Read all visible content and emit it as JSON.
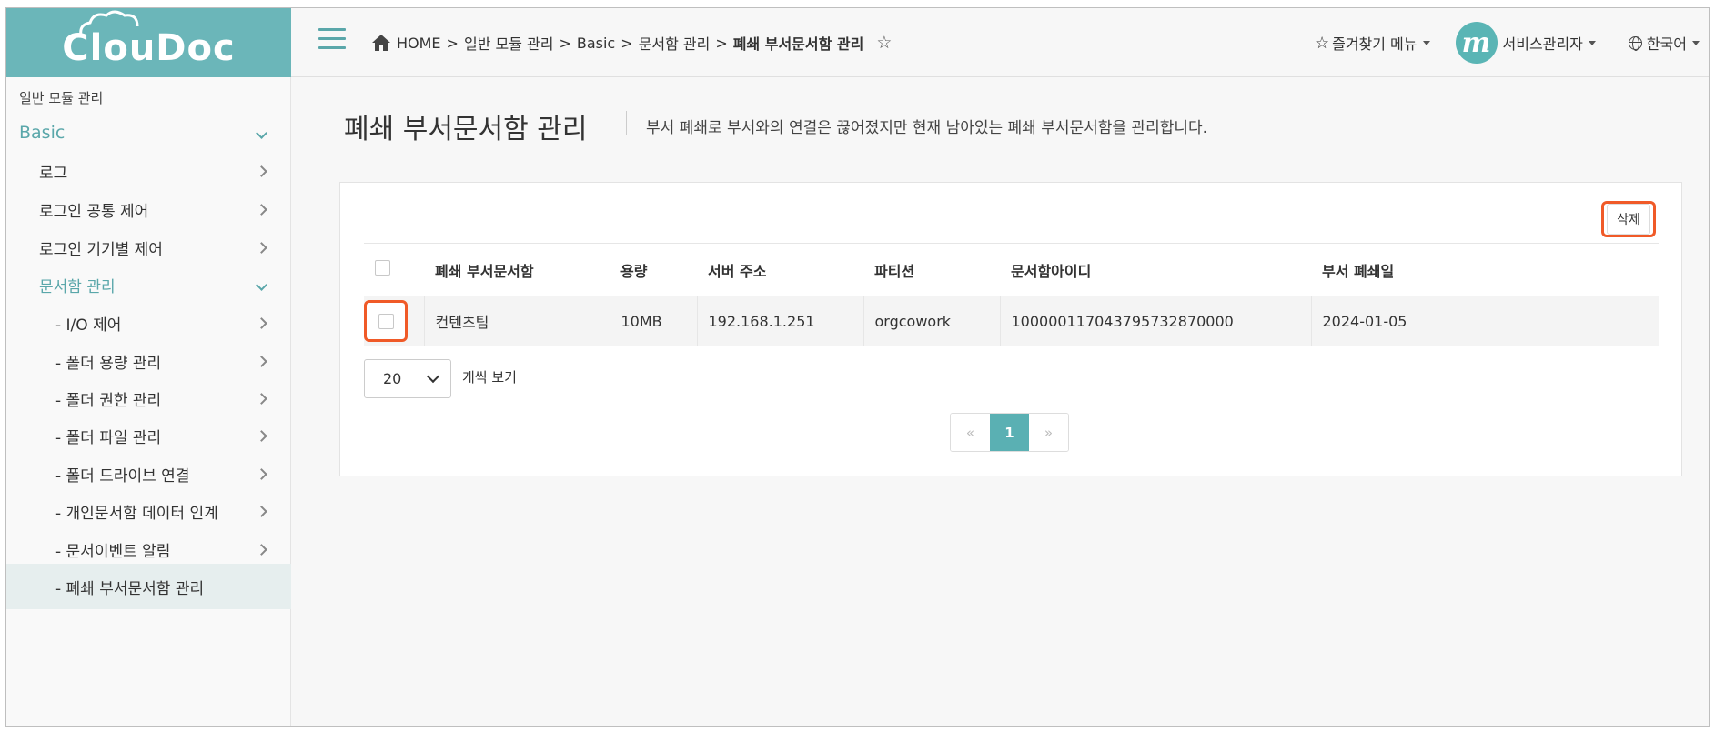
{
  "app": {
    "logo_text": "ClouDoc"
  },
  "colors": {
    "accent": "#5ab0b3",
    "highlight": "#f05a28",
    "logo_bg": "#6bb6b9"
  },
  "breadcrumb": {
    "home": "HOME",
    "items": [
      "일반 모듈 관리",
      "Basic",
      "문서함 관리"
    ],
    "current": "폐쇄 부서문서함 관리",
    "separator": ">"
  },
  "topbar": {
    "favorites_label": "즐겨찾기 메뉴",
    "user_avatar_letter": "m",
    "user_label": "서비스관리자",
    "language_label": "한국어"
  },
  "sidebar": {
    "section": "일반 모듈 관리",
    "basic": "Basic",
    "items": [
      "로그",
      "로그인 공통 제어",
      "로그인 기기별 제어",
      "문서함 관리",
      "- I/O 제어",
      "- 폴더 용량 관리",
      "- 폴더 권한 관리",
      "- 폴더 파일 관리",
      "- 폴더 드라이브 연결",
      "- 개인문서함 데이터 인계",
      "- 문서이벤트 알림",
      "- 폐쇄 부서문서함 관리"
    ]
  },
  "page": {
    "title": "폐쇄 부서문서함 관리",
    "description": "부서 폐쇄로 부서와의 연결은 끊어졌지만 현재 남아있는 폐쇄 부서문서함을 관리합니다.",
    "delete_label": "삭제"
  },
  "table": {
    "headers": [
      "폐쇄 부서문서함",
      "용량",
      "서버 주소",
      "파티션",
      "문서함아이디",
      "부서 폐쇄일"
    ],
    "rows": [
      [
        "컨텐츠팀",
        "10MB",
        "192.168.1.251",
        "orgcowork",
        "100000117043795732870000",
        "2024-01-05"
      ]
    ]
  },
  "pagination": {
    "page_size": "20",
    "page_size_label": "개씩 보기",
    "prev": "«",
    "current": "1",
    "next": "»"
  }
}
